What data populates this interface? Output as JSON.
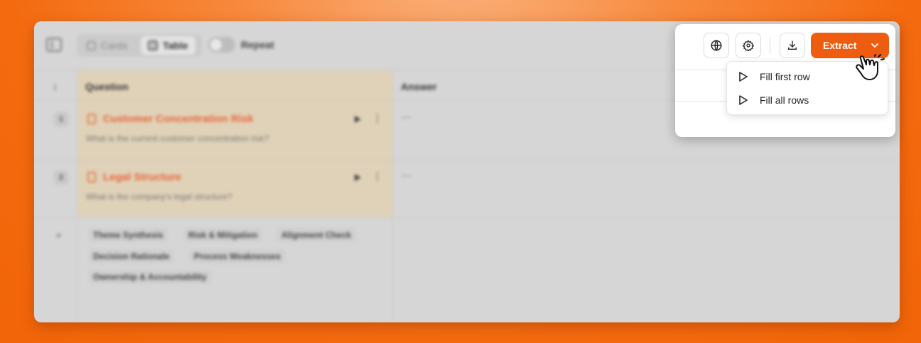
{
  "toolbar": {
    "view_cards": "Cards",
    "view_table": "Table",
    "repeat_label": "Repeat",
    "extract_label": "Extract"
  },
  "table": {
    "headers": {
      "question": "Question",
      "answer": "Answer"
    },
    "rows": [
      {
        "num": "1",
        "title": "Customer Concentration Risk",
        "desc": "What is the current customer concentration risk?",
        "answer": "—"
      },
      {
        "num": "2",
        "title": "Legal Structure",
        "desc": "What is the company's legal structure?",
        "answer": "—"
      }
    ],
    "add_symbol": "+",
    "templates": [
      "Theme Synthesis",
      "Risk & Mitigation",
      "Alignment Check",
      "Decision Rationale",
      "Process Weaknesses",
      "Ownership & Accountability"
    ]
  },
  "extract_menu": {
    "items": [
      "Fill first row",
      "Fill all rows"
    ]
  },
  "colors": {
    "accent": "#ee5d0f",
    "question_column_bg": "#e0d2b8",
    "question_title": "#e8643a"
  },
  "icons": [
    "sidebar-icon",
    "globe-icon",
    "gear-icon",
    "download-icon",
    "chevron-down-icon",
    "play-icon",
    "pointer-hand-icon"
  ]
}
